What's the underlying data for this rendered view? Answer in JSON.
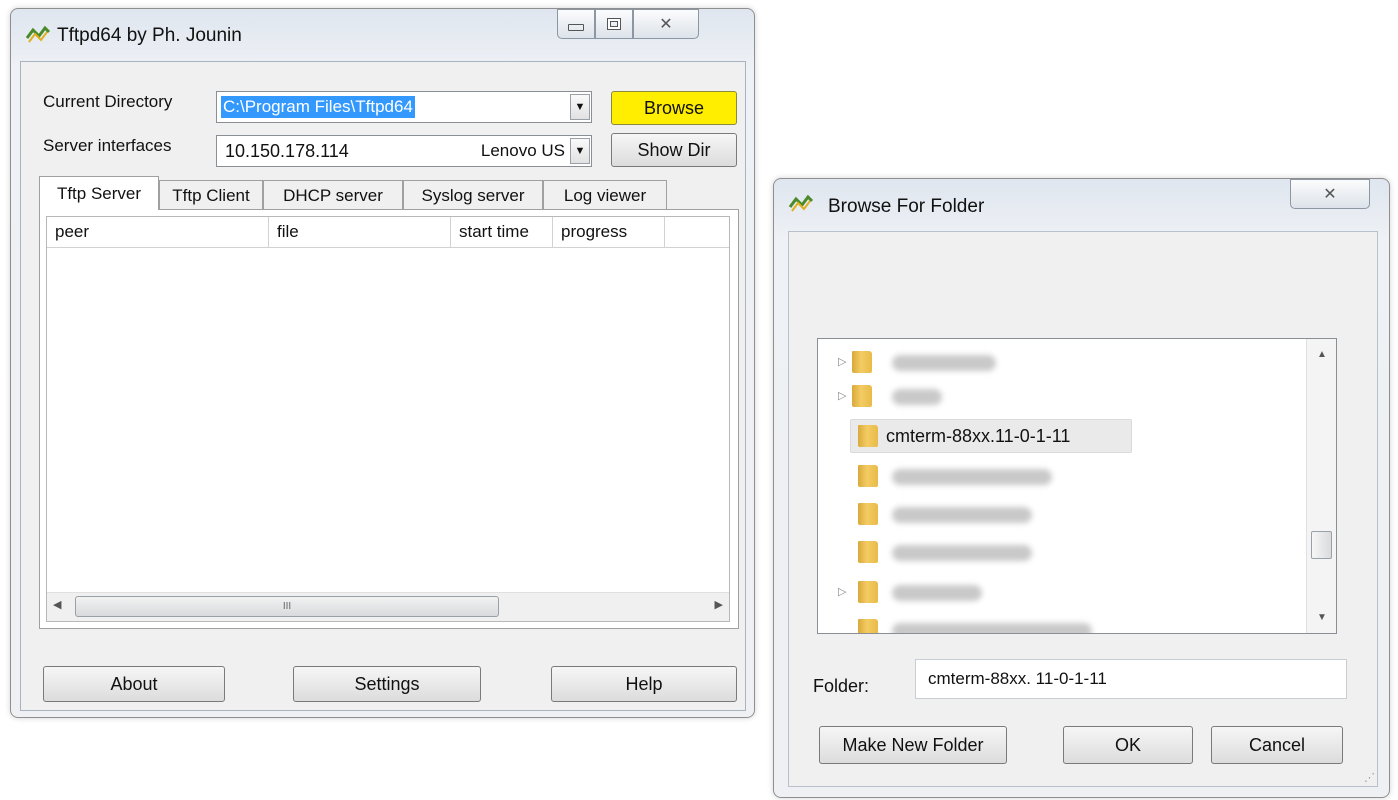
{
  "tftpd": {
    "title": "Tftpd64 by Ph. Jounin",
    "current_directory_label": "Current Directory",
    "current_directory_value": "C:\\Program Files\\Tftpd64",
    "server_interfaces_label": "Server interfaces",
    "server_interface_ip": "10.150.178.114",
    "server_interface_name": "Lenovo US",
    "browse_label": "Browse",
    "show_dir_label": "Show Dir",
    "tabs": [
      "Tftp Server",
      "Tftp Client",
      "DHCP server",
      "Syslog server",
      "Log viewer"
    ],
    "columns": [
      "peer",
      "file",
      "start time",
      "progress"
    ],
    "scroll_thumb_grip": "III",
    "about_label": "About",
    "settings_label": "Settings",
    "help_label": "Help",
    "colors": {
      "browse_highlight": "#ffee00",
      "selection": "#3399ff"
    }
  },
  "browse_dialog": {
    "title": "Browse For Folder",
    "selected_folder": "cmterm-88xx.11-0-1-11",
    "folder_label": "Folder:",
    "folder_value": "cmterm-88xx. 11-0-1-11",
    "make_new_folder_label": "Make New Folder",
    "ok_label": "OK",
    "cancel_label": "Cancel"
  }
}
